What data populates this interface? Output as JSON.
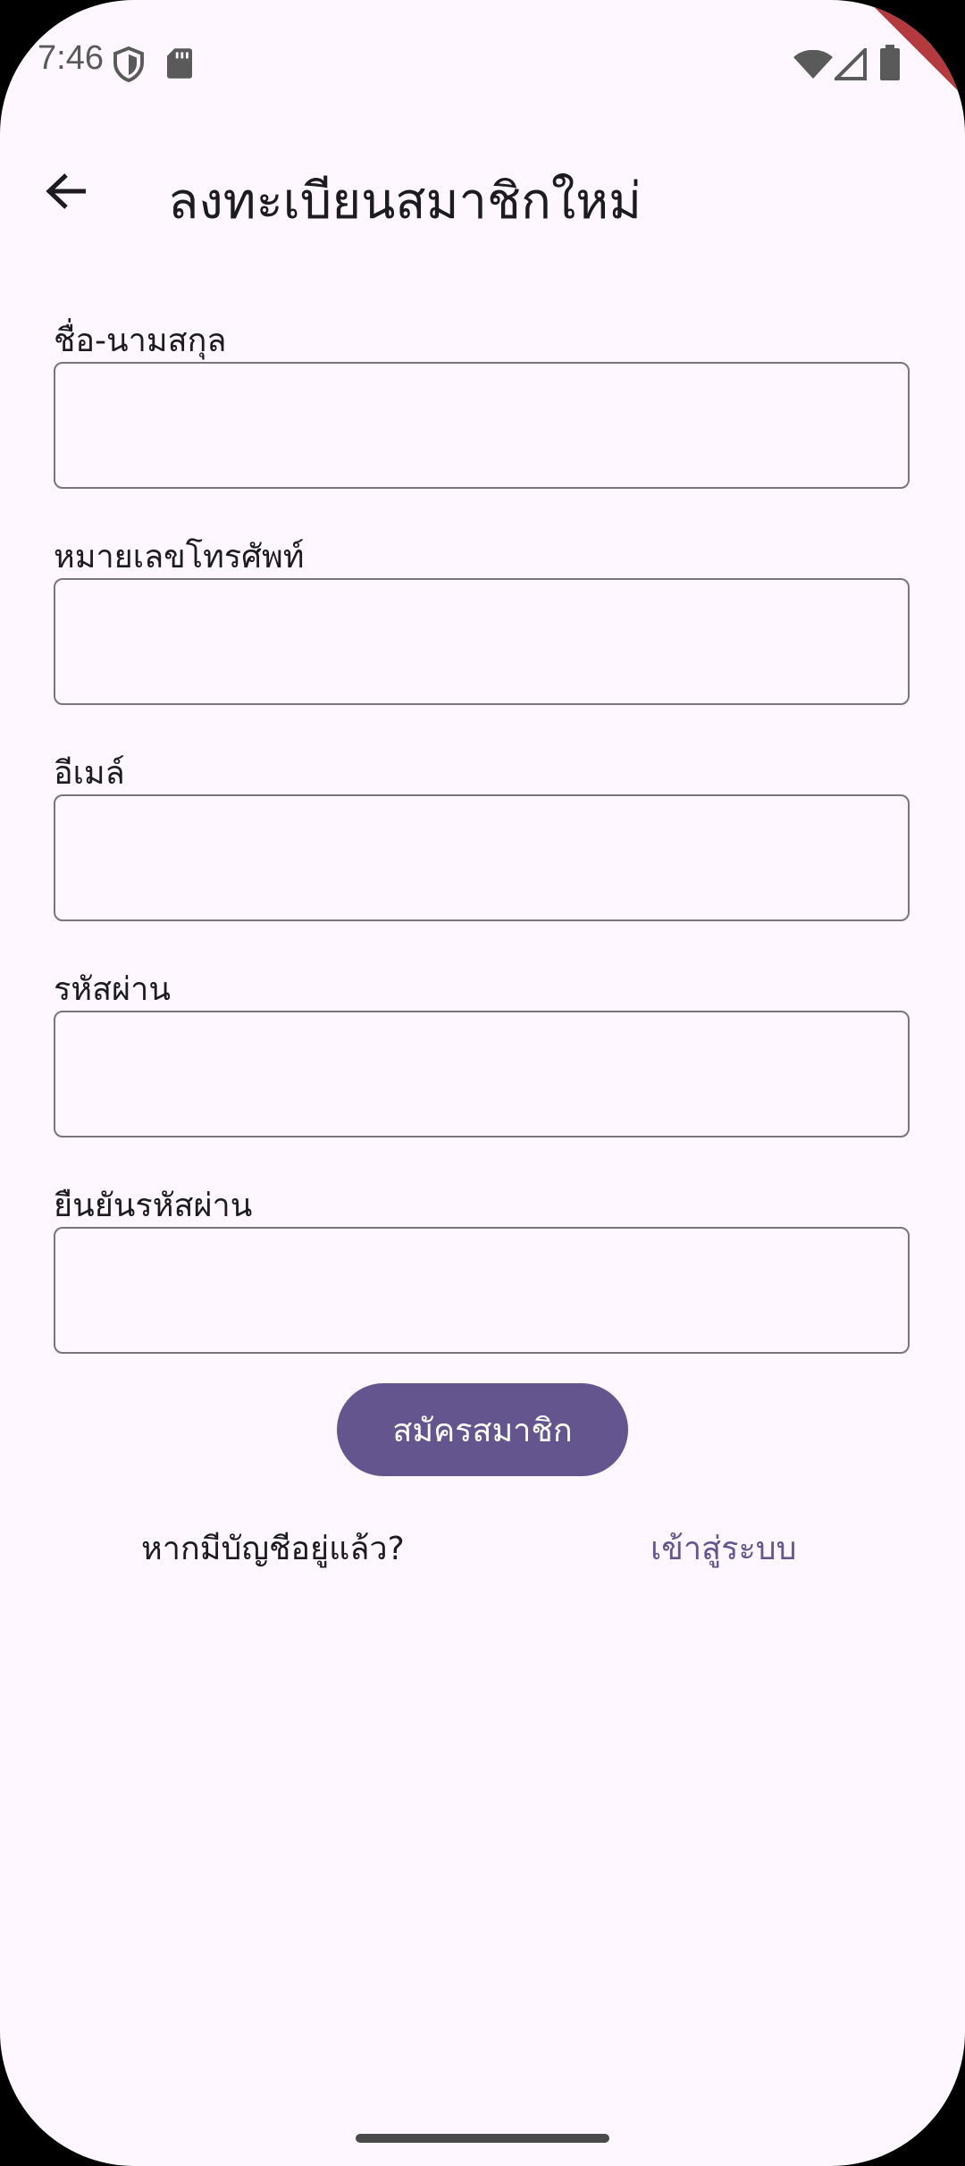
{
  "status_bar": {
    "time": "7:46",
    "icons": [
      "shield-icon",
      "sdcard-icon",
      "wifi-icon",
      "signal-icon",
      "battery-icon"
    ]
  },
  "debug_banner": "DEBUG",
  "app_bar": {
    "back_icon": "arrow-back-icon",
    "title": "ลงทะเบียนสมาชิกใหม่"
  },
  "form": {
    "fields": [
      {
        "label": "ชื่อ-นามสกุล",
        "value": "",
        "placeholder": ""
      },
      {
        "label": "หมายเลขโทรศัพท์",
        "value": "",
        "placeholder": ""
      },
      {
        "label": "อีเมล์",
        "value": "",
        "placeholder": ""
      },
      {
        "label": "รหัสผ่าน",
        "value": "",
        "placeholder": ""
      },
      {
        "label": "ยืนยันรหัสผ่าน",
        "value": "",
        "placeholder": ""
      }
    ],
    "submit_label": "สมัครสมาชิก"
  },
  "footer": {
    "prompt": "หากมีบัญชีอยู่แล้ว?",
    "login_link": "เข้าสู่ระบบ"
  },
  "colors": {
    "background": "#fef7ff",
    "primary": "#65558f",
    "outline": "#79747e",
    "text": "#1d1b20",
    "debug_ribbon": "#b43a3e"
  }
}
